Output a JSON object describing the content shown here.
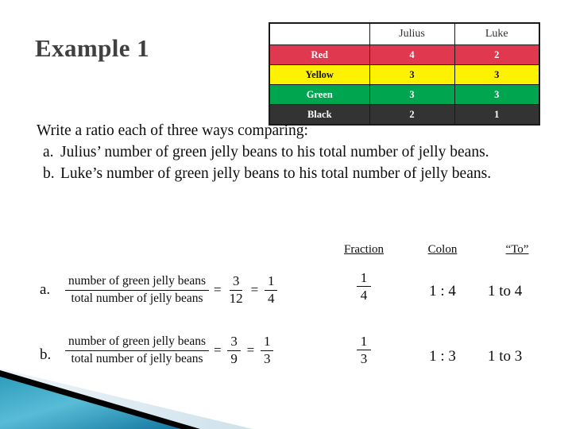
{
  "slide": {
    "title": "Example 1",
    "theme_colors": {
      "title_text": "#404040",
      "body_text": "#0d0d0d",
      "accent_teal": "#1f8db0",
      "accent_teal_light": "#55b9d4",
      "accent_pale": "#dce9f0",
      "accent_black": "#000000"
    }
  },
  "bean_table": {
    "colors": {
      "red": "#e0394f",
      "yellow": "#fff200",
      "green": "#00a550",
      "black": "#333333",
      "border": "#1a1a1a"
    },
    "corner_header": "",
    "headers": [
      "Julius",
      "Luke"
    ],
    "rows": [
      {
        "label": "Red",
        "julius": "4",
        "luke": "2"
      },
      {
        "label": "Yellow",
        "julius": "3",
        "luke": "3"
      },
      {
        "label": "Green",
        "julius": "3",
        "luke": "3"
      },
      {
        "label": "Black",
        "julius": "2",
        "luke": "1"
      }
    ]
  },
  "prompt": {
    "lead": "Write a ratio each of three ways comparing:",
    "items": [
      {
        "marker": "a.",
        "text": "Julius’ number of green jelly beans to his total number of jelly beans."
      },
      {
        "marker": "b.",
        "text": "Luke’s number of green jelly beans to his total number of jelly beans."
      }
    ]
  },
  "answers": {
    "column_headers": {
      "fraction": "Fraction",
      "colon": "Colon",
      "to": "“To”"
    },
    "rows": [
      {
        "marker": "a.",
        "expression": {
          "word_numerator": "number of green jelly beans",
          "word_denominator": "total number of jelly beans",
          "equals": "=",
          "raw_numerator": "3",
          "raw_denominator": "12",
          "equals2": "=",
          "simple_numerator": "1",
          "simple_denominator": "4"
        },
        "fraction_numerator": "1",
        "fraction_denominator": "4",
        "colon": "1 : 4",
        "to": "1 to 4"
      },
      {
        "marker": "b.",
        "expression": {
          "word_numerator": "number of green jelly beans",
          "word_denominator": "total number of jelly beans",
          "equals": "=",
          "raw_numerator": "3",
          "raw_denominator": "9",
          "equals2": "=",
          "simple_numerator": "1",
          "simple_denominator": "3"
        },
        "fraction_numerator": "1",
        "fraction_denominator": "3",
        "colon": "1 : 3",
        "to": "1 to 3"
      }
    ]
  }
}
